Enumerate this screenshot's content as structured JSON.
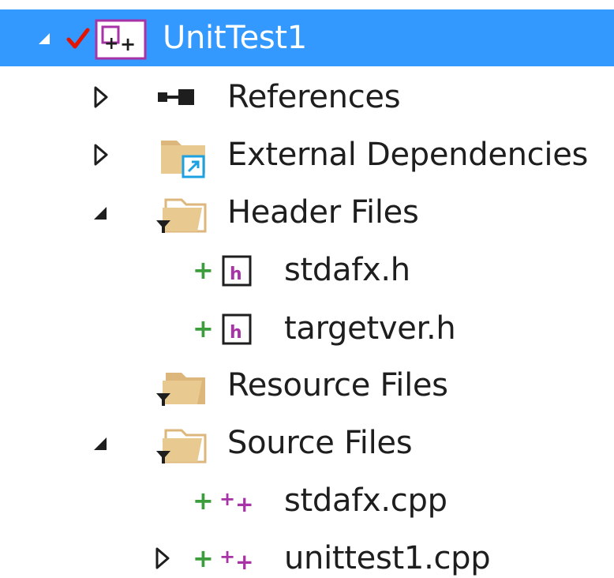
{
  "colors": {
    "selection": "#3399ff",
    "text": "#1e1e1e",
    "added_plus": "#3c9d3c",
    "cpp_purple": "#a733a7",
    "folder_tan": "#dcb67a",
    "checkmark": "#e51400"
  },
  "tree": {
    "project": {
      "label": "UnitTest1",
      "expanded": true,
      "icon": "cpp-test-project-icon",
      "status_icon": "checked-in-icon"
    },
    "items": [
      {
        "label": "References",
        "icon": "references-icon",
        "expander": "collapsed"
      },
      {
        "label": "External Dependencies",
        "icon": "external-dependencies-folder-icon",
        "expander": "collapsed"
      },
      {
        "label": "Header Files",
        "icon": "filter-folder-icon",
        "expander": "expanded"
      },
      {
        "label": "stdafx.h",
        "icon": "header-file-icon",
        "status_icon": "pending-add-icon"
      },
      {
        "label": "targetver.h",
        "icon": "header-file-icon",
        "status_icon": "pending-add-icon"
      },
      {
        "label": "Resource Files",
        "icon": "filter-folder-icon",
        "expander": "none"
      },
      {
        "label": "Source Files",
        "icon": "filter-folder-icon",
        "expander": "expanded"
      },
      {
        "label": "stdafx.cpp",
        "icon": "cpp-file-icon",
        "status_icon": "pending-add-icon"
      },
      {
        "label": "unittest1.cpp",
        "icon": "cpp-file-icon",
        "status_icon": "pending-add-icon",
        "expander": "collapsed"
      }
    ]
  }
}
